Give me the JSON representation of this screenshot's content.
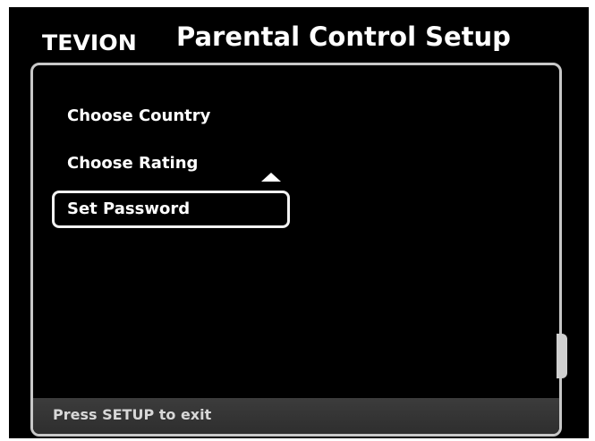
{
  "header": {
    "logo_text": "TEVION",
    "title": "Parental Control Setup"
  },
  "menu": {
    "items": [
      {
        "label": "Choose Country"
      },
      {
        "label": "Choose Rating"
      },
      {
        "label": "Set Password",
        "selected": true
      }
    ],
    "scroll_indicator_icon": "triangle-up-icon"
  },
  "footer": {
    "hint": "Press SETUP to exit"
  },
  "colors": {
    "background": "#000000",
    "text": "#ffffff",
    "panel_border": "#c8c8c8",
    "footer_bar": "#353535"
  }
}
